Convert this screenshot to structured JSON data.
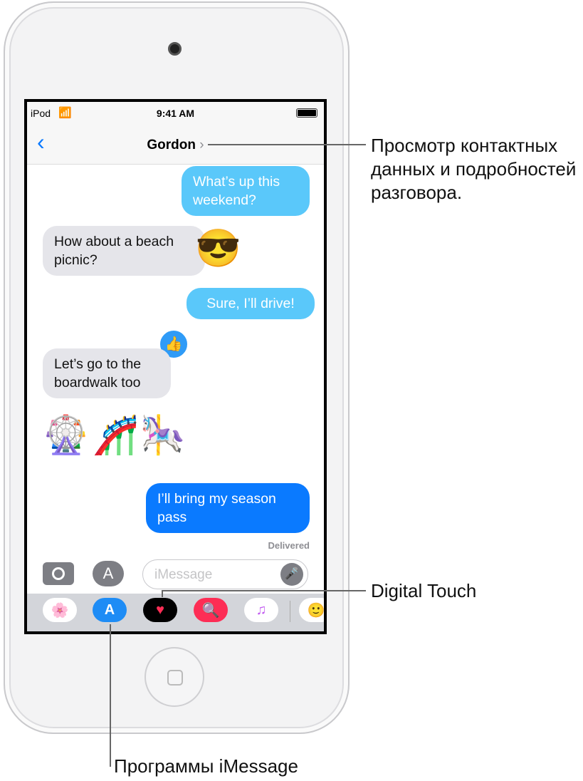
{
  "status": {
    "carrier": "iPod",
    "time": "9:41 AM"
  },
  "nav": {
    "title": "Gordon"
  },
  "messages": [
    {
      "side": "out",
      "text": "What’s up this weekend?"
    },
    {
      "side": "in",
      "text": "How about a beach picnic?"
    },
    {
      "side": "out",
      "text": "Sure, I’ll drive!"
    },
    {
      "side": "in",
      "text": "Let’s go to the boardwalk too"
    },
    {
      "side": "out",
      "text": "I’ll bring my season pass"
    }
  ],
  "emojis": {
    "sunglasses": "😎",
    "ferris": "🎡",
    "coaster": "🎢",
    "carousel": "🎠",
    "smiley": "🙂"
  },
  "delivered": "Delivered",
  "input": {
    "placeholder": "iMessage"
  },
  "callouts": {
    "contact": "Просмотр контактных данных и подробностей разговора.",
    "digital_touch": "Digital Touch",
    "imessage_apps": "Программы iMessage"
  },
  "colors": {
    "accent": "#0a7aff",
    "light_bubble": "#5ac8fa",
    "incoming": "#e5e5ea"
  }
}
